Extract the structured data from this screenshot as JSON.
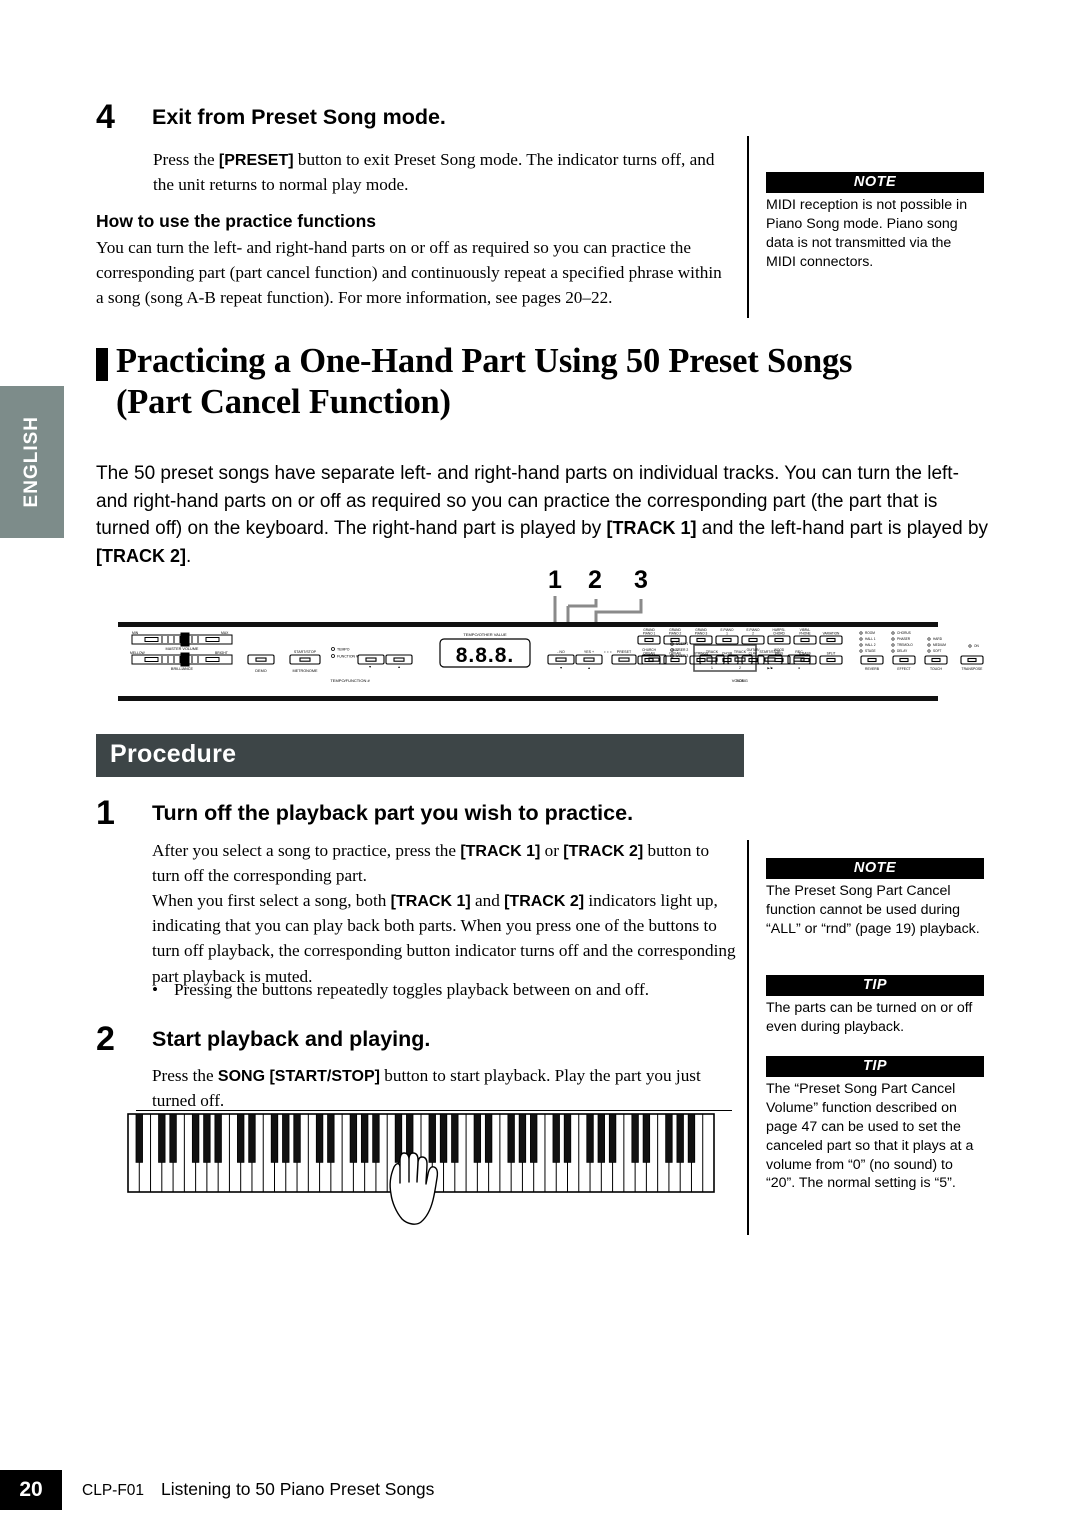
{
  "language_tab": "ENGLISH",
  "step4": {
    "number": "4",
    "title": "Exit from Preset Song mode.",
    "body_1": "Press the ",
    "body_bold": "[PRESET]",
    "body_2": " button to exit Preset Song mode. The indicator turns off, and the unit returns to normal play mode.",
    "subhead": "How to use the practice functions",
    "practice_body": "You can turn the left- and right-hand parts on or off as required so you can practice the corresponding part (part cancel function) and continuously repeat a specified phrase within a song (song A-B repeat function). For more information, see pages 20–22."
  },
  "note_midi": {
    "label": "NOTE",
    "body": "MIDI reception is not possible in Piano Song mode. Piano song data is not transmitted via the MIDI connectors."
  },
  "section": {
    "title_line1": "Practicing a One-Hand Part Using 50 Preset Songs",
    "title_line2": "(Part Cancel Function)",
    "intro_1": "The 50 preset songs have separate left- and right-hand parts on individual tracks. You can turn the left- and right-hand parts on or off as required so you can practice the corresponding part (the part that is turned off) on the keyboard. The right-hand part is played by ",
    "intro_b1": "[TRACK 1]",
    "intro_2": " and the left-hand part is played by ",
    "intro_b2": "[TRACK 2]",
    "intro_3": "."
  },
  "callouts": [
    {
      "label": "1"
    },
    {
      "label": "2"
    },
    {
      "label": "3"
    }
  ],
  "panel": {
    "master_volume": "MASTER VOLUME",
    "master_min": "MIN",
    "master_max": "MAX",
    "brilliance": "BRILLIANCE",
    "brilliance_min": "MELLOW",
    "brilliance_max": "BRIGHT",
    "demo": "DEMO",
    "metronome": "METRONOME",
    "start_stop": "START/STOP",
    "led_tempo": "TEMPO",
    "led_function": "FUNCTION #",
    "tempo_function": "TEMPO/FUNCTION #",
    "display_caption": "TEMPO/OTHER VALUE",
    "display_value": "8.8.8.",
    "minus_no": "- NO",
    "plus_yes": "YES +",
    "preset": "PRESET",
    "user1": "USER 1",
    "user2": "USER 2",
    "user3": "USER 3",
    "track1": "TRACK",
    "track1_n": "1",
    "track2": "TRACK",
    "track2_n": "2",
    "song_start_stop": "START/STOP",
    "rec": "REC",
    "song_group": "SONG",
    "voice_group": "VOICE",
    "voices_row1": [
      "GRAND PIANO 1",
      "GRAND PIANO 2",
      "GRAND PIANO 3",
      "E.PIANO 1",
      "E.PIANO 2",
      "HARPSI- CHORD",
      "VIBRA- PHONE",
      "VARIATION"
    ],
    "voices_row2": [
      "CHURCH ORGAN",
      "JAZZ ORGAN",
      "STRINGS",
      "CHOIR",
      "GUITAR/ CLAV.",
      "WOOD BASS",
      "E.BASS",
      "SPLIT"
    ],
    "reverb": "REVERB",
    "reverb_opts": [
      "ROOM",
      "HALL 1",
      "HALL 2",
      "STAGE"
    ],
    "effect": "EFFECT",
    "effect_opts": [
      "CHORUS",
      "PHASER",
      "TREMOLO",
      "DELAY"
    ],
    "touch": "TOUCH",
    "touch_opts": [
      "HARD",
      "MEDIUM",
      "SOFT"
    ],
    "transpose": "TRANSPOSE",
    "transpose_on": "ON"
  },
  "procedure": {
    "banner": "Procedure",
    "step1": {
      "number": "1",
      "title": "Turn off the playback part you wish to practice.",
      "p1_a": "After you select a song to practice, press the ",
      "p1_b1": "[TRACK 1]",
      "p1_b": " or ",
      "p1_b2": "[TRACK 2]",
      "p1_c": " button to turn off the corresponding part.",
      "p2_a": "When you first select a song, both ",
      "p2_b1": "[TRACK 1]",
      "p2_b": " and ",
      "p2_b2": "[TRACK 2]",
      "p2_c": " indicators light up, indicating that you can play back both parts. When you press one of the buttons to turn off playback, the corresponding button indicator turns off and the corresponding part playback is muted.",
      "bullet": "Pressing the buttons repeatedly toggles playback between on and off."
    },
    "step2": {
      "number": "2",
      "title": "Start playback and playing.",
      "p1_a": "Press the ",
      "p1_b": "SONG [START/STOP]",
      "p1_c": " button to start playback. Play the part you just turned off."
    }
  },
  "note_partcancel": {
    "label": "NOTE",
    "body": "The Preset Song Part Cancel function cannot be used during “ALL” or “rnd” (page 19) playback."
  },
  "tip_parts": {
    "label": "TIP",
    "body": "The parts can be turned on or off even during playback."
  },
  "tip_volume": {
    "label": "TIP",
    "body": "The “Preset Song Part Cancel Volume” function described on page 47 can be used to set the canceled part so that it plays at a volume from “0” (no sound) to “20”. The normal setting is “5”."
  },
  "footer": {
    "page_number": "20",
    "model": "CLP-F01",
    "chapter": "Listening to 50 Piano Preset Songs"
  },
  "colors": {
    "lang_tab": "#7d8c8a",
    "procedure_bar": "#3d4547",
    "box_head": "#000000",
    "callout_leader": "#8a8a8a"
  }
}
